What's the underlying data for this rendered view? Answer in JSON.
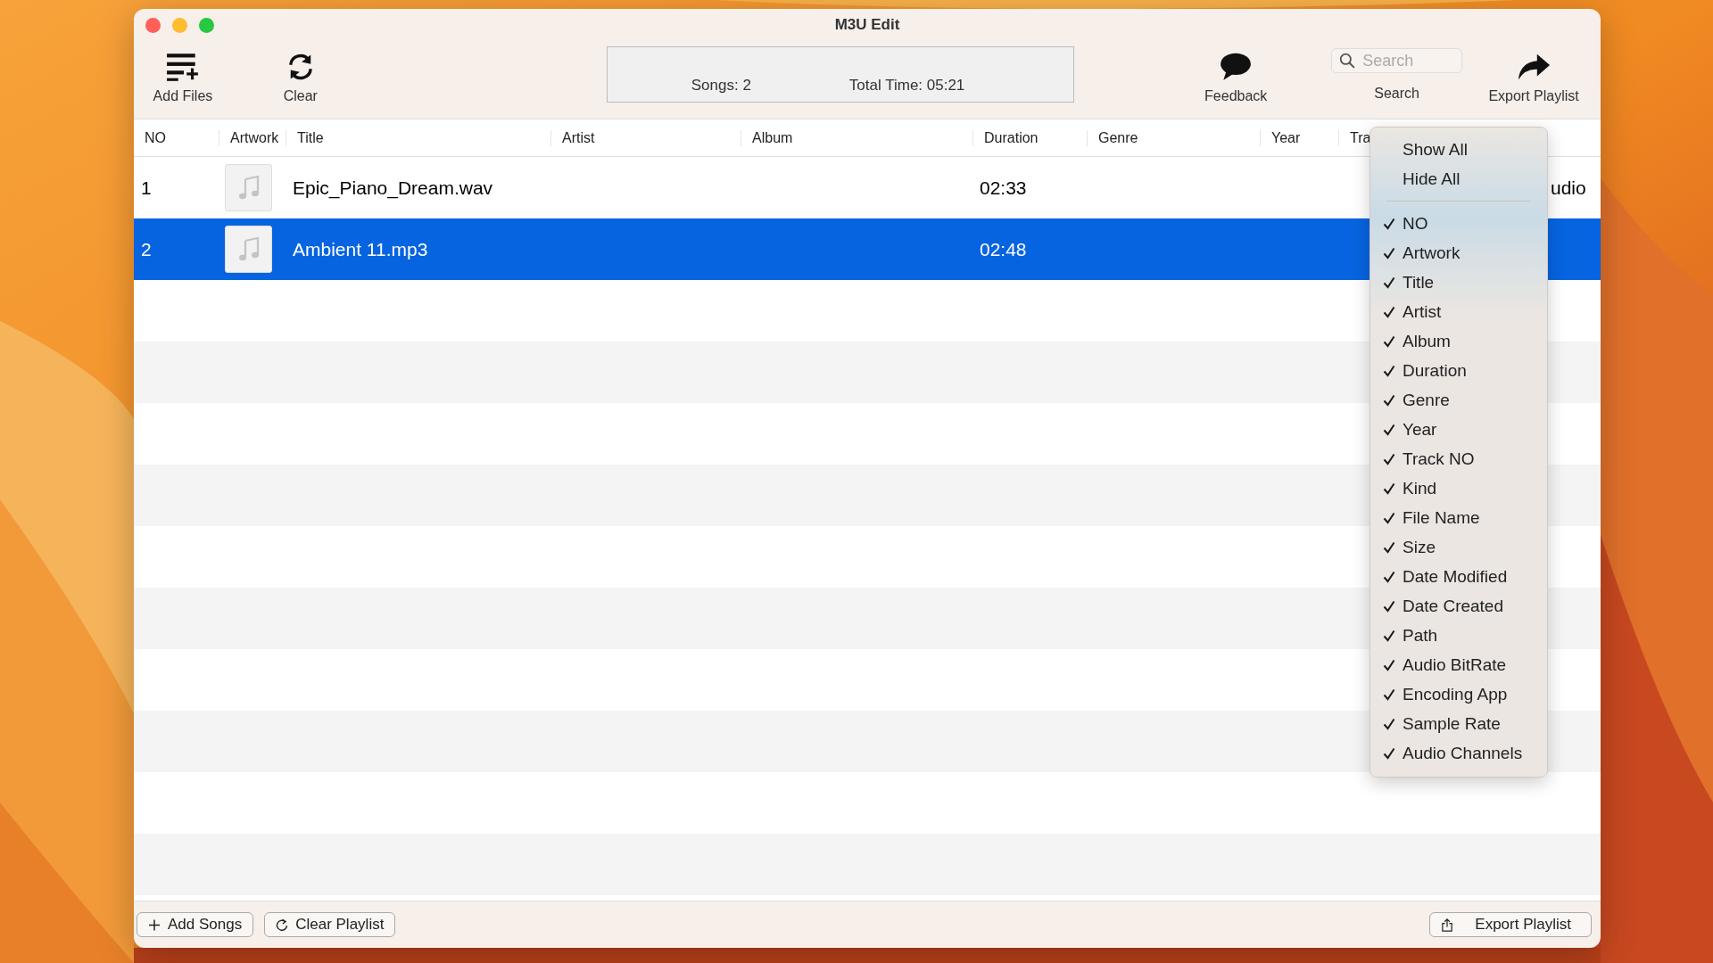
{
  "window": {
    "title": "M3U Edit"
  },
  "toolbar": {
    "left": [
      {
        "kind": "add",
        "label": "Add Files"
      },
      {
        "kind": "clear",
        "label": "Clear"
      }
    ],
    "status": {
      "songs": "Songs: 2",
      "total_time": "Total Time: 05:21"
    },
    "feedback": {
      "label": "Feedback"
    },
    "search": {
      "placeholder": "Search",
      "label": "Search"
    },
    "export": {
      "label": "Export Playlist"
    }
  },
  "table": {
    "columns": [
      "NO",
      "Artwork",
      "Title",
      "Artist",
      "Album",
      "Duration",
      "Genre",
      "Year",
      "Tra"
    ],
    "rows": [
      {
        "no": "1",
        "title": "Epic_Piano_Dream.wav",
        "duration": "02:33",
        "column_10": "udio",
        "selected": false
      },
      {
        "no": "2",
        "title": "Ambient 11.mp3",
        "duration": "02:48",
        "selected": true
      }
    ]
  },
  "column_menu": {
    "actions": [
      "Show All",
      "Hide All"
    ],
    "items": [
      {
        "label": "NO",
        "checked": true
      },
      {
        "label": "Artwork",
        "checked": true
      },
      {
        "label": "Title",
        "checked": true
      },
      {
        "label": "Artist",
        "checked": true
      },
      {
        "label": "Album",
        "checked": true
      },
      {
        "label": "Duration",
        "checked": true
      },
      {
        "label": "Genre",
        "checked": true
      },
      {
        "label": "Year",
        "checked": true
      },
      {
        "label": "Track NO",
        "checked": true
      },
      {
        "label": "Kind",
        "checked": true
      },
      {
        "label": "File Name",
        "checked": true
      },
      {
        "label": "Size",
        "checked": true
      },
      {
        "label": "Date Modified",
        "checked": true
      },
      {
        "label": "Date Created",
        "checked": true
      },
      {
        "label": "Path",
        "checked": true
      },
      {
        "label": "Audio BitRate",
        "checked": true
      },
      {
        "label": "Encoding App",
        "checked": true
      },
      {
        "label": "Sample Rate",
        "checked": true
      },
      {
        "label": "Audio Channels",
        "checked": true
      }
    ]
  },
  "bottom_bar": {
    "left": [
      {
        "kind": "add",
        "label": "Add Songs"
      },
      {
        "kind": "refresh",
        "label": "Clear Playlist"
      }
    ],
    "right": {
      "kind": "share",
      "label": "Export Playlist"
    }
  }
}
